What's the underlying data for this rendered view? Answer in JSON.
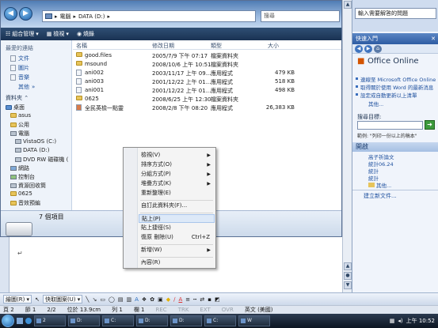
{
  "explorer": {
    "address_parts": [
      "電腦",
      "DATA (D:)"
    ],
    "search_placeholder": "搜尋",
    "toolbar": {
      "organize": "組合管理",
      "view": "檢視",
      "burn": "燒錄"
    },
    "favorites_title": "最愛的連結",
    "favorites": [
      "文件",
      "圖片",
      "音樂",
      "其他"
    ],
    "folders_title": "資料夾",
    "tree": [
      "桌面",
      "asus",
      "公用",
      "電腦",
      "VistaOS (C:)",
      "DATA (D:)",
      "DVD RW 磁碟機 (",
      "網路",
      "控制台",
      "資源回收筒",
      "0625",
      "音效預編"
    ],
    "columns": {
      "name": "名稱",
      "date": "修改日期",
      "type": "類型",
      "size": "大小"
    },
    "files": [
      {
        "name": "good.files",
        "date": "2005/7/9 下午 07:17",
        "type": "檔案資料夾",
        "size": "",
        "kind": "folder"
      },
      {
        "name": "msound",
        "date": "2008/10/6 上午 10:51",
        "type": "檔案資料夾",
        "size": "",
        "kind": "folder"
      },
      {
        "name": "ani002",
        "date": "2003/11/17 上午 09...",
        "type": "應用程式",
        "size": "479 KB",
        "kind": "app"
      },
      {
        "name": "ani003",
        "date": "2001/12/22 上午 01...",
        "type": "應用程式",
        "size": "518 KB",
        "kind": "app"
      },
      {
        "name": "ani001",
        "date": "2001/12/22 上午 01...",
        "type": "應用程式",
        "size": "498 KB",
        "kind": "app"
      },
      {
        "name": "0625",
        "date": "2008/6/25 上午 12:30",
        "type": "檔案資料夾",
        "size": "",
        "kind": "folder"
      },
      {
        "name": "全民英檢一點靈",
        "date": "2008/2/8 下午 08:20",
        "type": "應用程式",
        "size": "26,383 KB",
        "kind": "app"
      }
    ],
    "status_count": "7 個項目"
  },
  "context_menu": {
    "items": [
      {
        "label": "檢視(V)",
        "submenu": true
      },
      {
        "label": "排序方式(O)",
        "submenu": true
      },
      {
        "label": "分組方式(P)",
        "submenu": true
      },
      {
        "label": "堆疊方式(K)",
        "submenu": true
      },
      {
        "label": "重新整理(E)",
        "submenu": false
      },
      {
        "label": "自訂此資料夾(F)...",
        "submenu": false
      },
      {
        "label": "貼上(P)",
        "submenu": false,
        "highlighted": true
      },
      {
        "label": "貼上捷徑(S)",
        "submenu": false
      },
      {
        "label": "復原 刪除(U)",
        "submenu": false,
        "shortcut": "Ctrl+Z"
      },
      {
        "label": "新增(W)",
        "submenu": true
      },
      {
        "label": "內容(R)",
        "submenu": false
      }
    ]
  },
  "task_pane": {
    "help_search": "輸入需要解答的問題",
    "title": "快速入門",
    "office_logo": "Office Online",
    "links": [
      "連線至 Microsoft Office Online",
      "取得關於使用 Word 的最新消息",
      "設定成自動更新以上清單",
      "其他..."
    ],
    "search_label": "搜尋目標:",
    "example": "範例: \"列印一份以上的稿本\"",
    "open_title": "開啟",
    "recent": [
      "高子祈論文",
      "統計06.24",
      "統計",
      "統計",
      "其他..."
    ],
    "new_doc": "建立新文件..."
  },
  "draw_toolbar": {
    "draw": "繪圖(R)",
    "autoshapes": "快取圖案(U)"
  },
  "status_bar": {
    "page": "頁 2",
    "section": "節 1",
    "pages": "2/2",
    "position": "位於 13.9cm",
    "line": "列 1",
    "col": "欄 1",
    "rec": "REC",
    "trk": "TRK",
    "ext": "EXT",
    "ovr": "OVR",
    "lang": "英文 (美國)"
  },
  "taskbar": {
    "buttons": [
      "2",
      "D:",
      "C:",
      "D:",
      "D:",
      "C:",
      "W"
    ],
    "clock": "上午 10:52"
  }
}
